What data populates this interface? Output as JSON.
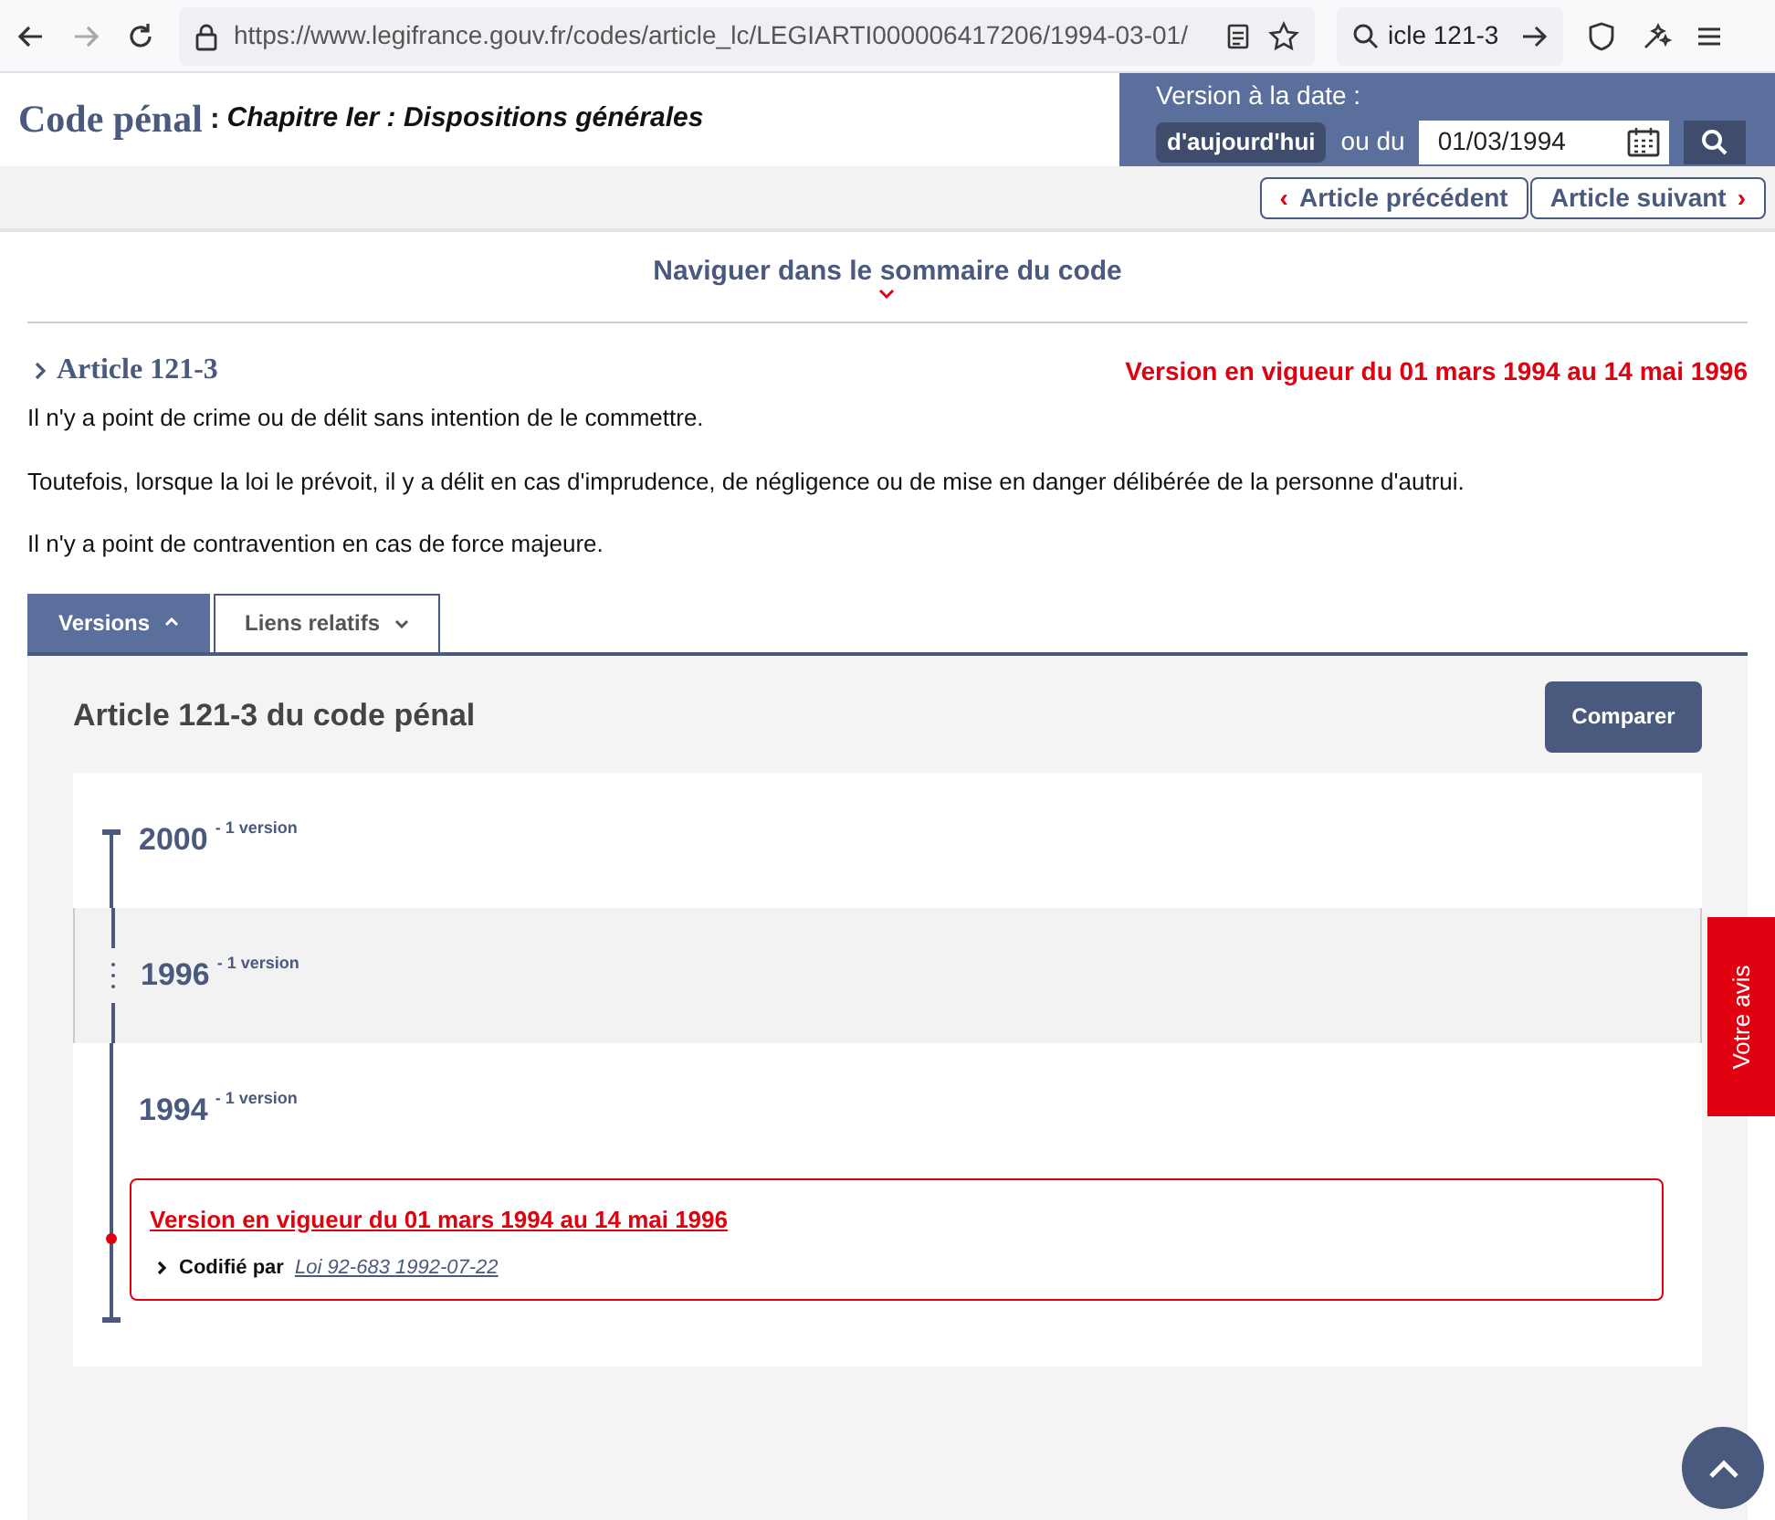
{
  "browser": {
    "url": "https://www.legifrance.gouv.fr/codes/article_lc/LEGIARTI000006417206/1994-03-01/",
    "search": "icle 121-3"
  },
  "header": {
    "code": "Code pénal",
    "separator": ":",
    "chapter": "Chapitre Ier : Dispositions générales"
  },
  "version_picker": {
    "label": "Version à la date :",
    "today": "d'aujourd'hui",
    "or": "ou du",
    "date": "01/03/1994"
  },
  "article_nav": [
    {
      "label": "Article précédent",
      "chevron": "‹"
    },
    {
      "label": "Article suivant",
      "chevron": "›"
    }
  ],
  "summary_link": "Naviguer dans le sommaire du code",
  "article": {
    "title": "Article 121-3",
    "validity": "Version en vigueur du 01 mars 1994 au 14 mai 1996",
    "paragraphs": [
      "Il n'y a point de crime ou de délit sans intention de le commettre.",
      "Toutefois, lorsque la loi le prévoit, il y a délit en cas d'imprudence, de négligence ou de mise en danger délibérée de la personne d'autrui.",
      "Il n'y a point de contravention en cas de force majeure."
    ]
  },
  "tabs": [
    {
      "label": "Versions",
      "selected": true
    },
    {
      "label": "Liens relatifs",
      "selected": false
    }
  ],
  "versions_panel": {
    "title": "Article 121-3 du code pénal",
    "compare_button": "Comparer",
    "years": [
      {
        "year": "2000",
        "count": "- 1 version",
        "highlighted": false
      },
      {
        "year": "1996",
        "count": "- 1 version",
        "highlighted": true
      },
      {
        "year": "1994",
        "count": "- 1 version",
        "highlighted": false,
        "versions": [
          {
            "title": "Version en vigueur du 01 mars 1994 au 14 mai 1996",
            "source_label": "Codifié par",
            "source_link": "Loi 92-683 1992-07-22"
          }
        ]
      }
    ]
  },
  "feedback_tab": "Votre avis"
}
